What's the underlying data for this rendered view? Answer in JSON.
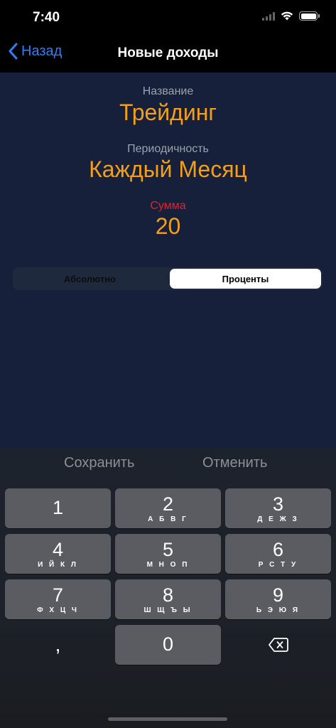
{
  "status_bar": {
    "time": "7:40"
  },
  "nav": {
    "back_label": "Назад",
    "title": "Новые доходы"
  },
  "form": {
    "name_label": "Название",
    "name_value": "Трейдинг",
    "period_label": "Периодичность",
    "period_value": "Каждый Месяц",
    "amount_label": "Сумма",
    "amount_value": "20"
  },
  "segmented": {
    "options": [
      "Абсолютно",
      "Проценты"
    ],
    "selected": "Проценты"
  },
  "actions": {
    "save": "Сохранить",
    "cancel": "Отменить"
  },
  "keypad": {
    "keys": [
      {
        "num": "1",
        "letters": ""
      },
      {
        "num": "2",
        "letters": "А Б В Г"
      },
      {
        "num": "3",
        "letters": "Д Е Ж З"
      },
      {
        "num": "4",
        "letters": "И Й К Л"
      },
      {
        "num": "5",
        "letters": "М Н О П"
      },
      {
        "num": "6",
        "letters": "Р С Т У"
      },
      {
        "num": "7",
        "letters": "Ф Х Ц Ч"
      },
      {
        "num": "8",
        "letters": "Ш Щ Ъ Ы"
      },
      {
        "num": "9",
        "letters": "Ь Э Ю Я"
      }
    ],
    "decimal": ",",
    "zero": "0",
    "backspace_icon": "delete-left-icon"
  },
  "colors": {
    "accent": "#f29f1c",
    "link": "#2f7ff6",
    "alert": "#e5202b",
    "background": "#16203a"
  }
}
